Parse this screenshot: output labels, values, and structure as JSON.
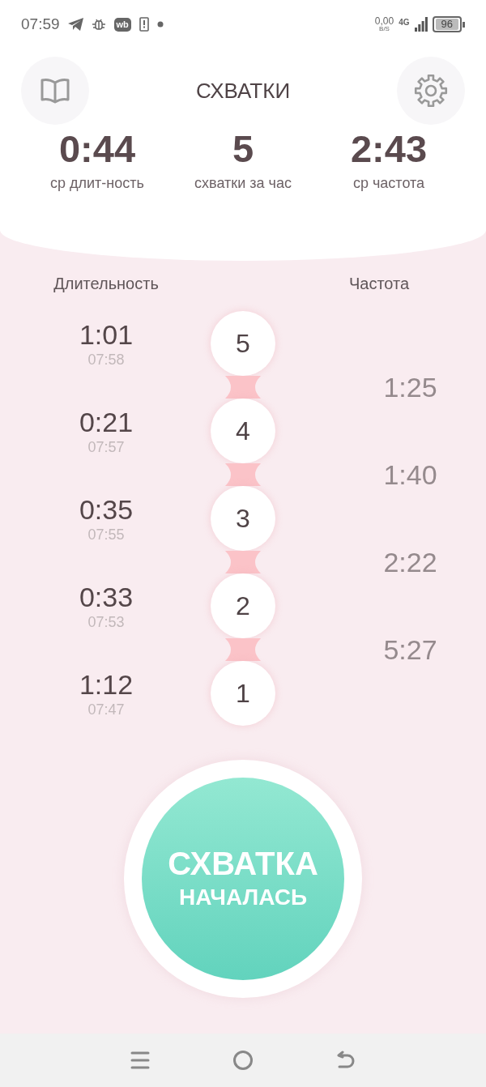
{
  "status_bar": {
    "time": "07:59",
    "app_badge": "wb",
    "speed": "0,00",
    "speed_unit": "B/S",
    "network": "4G",
    "battery": "96"
  },
  "header": {
    "title": "СХВАТКИ"
  },
  "stats": [
    {
      "value": "0:44",
      "label": "ср длит-ность"
    },
    {
      "value": "5",
      "label": "схватки за час"
    },
    {
      "value": "2:43",
      "label": "ср частота"
    }
  ],
  "columns": {
    "duration": "Длительность",
    "frequency": "Частота"
  },
  "contractions": [
    {
      "number": "5",
      "duration": "1:01",
      "start": "07:58"
    },
    {
      "number": "4",
      "duration": "0:21",
      "start": "07:57"
    },
    {
      "number": "3",
      "duration": "0:35",
      "start": "07:55"
    },
    {
      "number": "2",
      "duration": "0:33",
      "start": "07:53"
    },
    {
      "number": "1",
      "duration": "1:12",
      "start": "07:47"
    }
  ],
  "frequencies": [
    "1:25",
    "1:40",
    "2:22",
    "5:27"
  ],
  "start_button": {
    "line_1": "СХВАТКА",
    "line_2": "НАЧАЛАСЬ"
  }
}
